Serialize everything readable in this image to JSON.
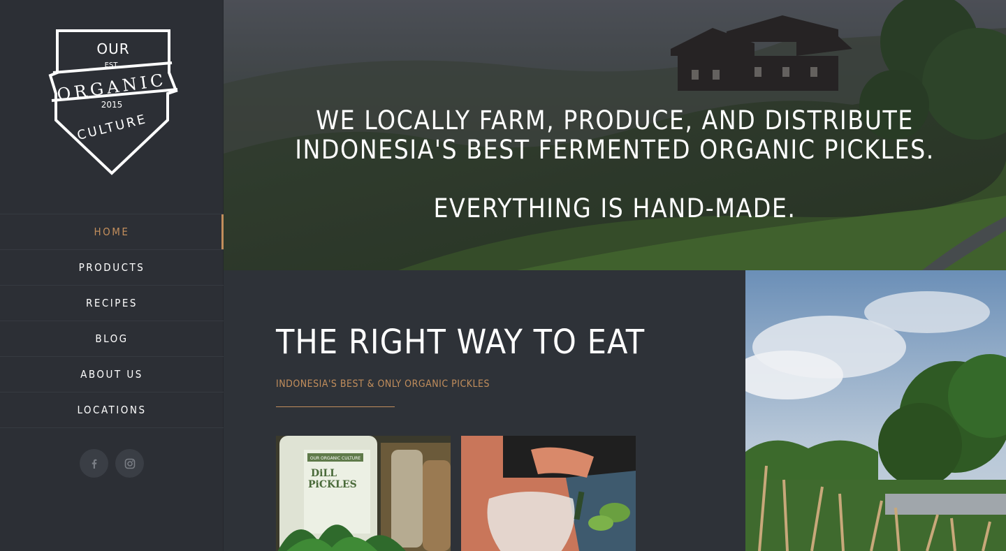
{
  "logo": {
    "line1": "OUR",
    "est": "EST.",
    "line2": "ORGANIC",
    "year": "2015",
    "line3": "CULTURE"
  },
  "nav": {
    "items": [
      {
        "label": "HOME",
        "active": true
      },
      {
        "label": "PRODUCTS",
        "active": false
      },
      {
        "label": "RECIPES",
        "active": false
      },
      {
        "label": "BLOG",
        "active": false
      },
      {
        "label": "ABOUT US",
        "active": false
      },
      {
        "label": "LOCATIONS",
        "active": false
      }
    ]
  },
  "social": {
    "facebook_icon": "facebook-icon",
    "instagram_icon": "instagram-icon"
  },
  "hero": {
    "line1": "WE LOCALLY FARM, PRODUCE, AND DISTRIBUTE",
    "line2": "INDONESIA'S BEST FERMENTED ORGANIC PICKLES.",
    "line3": "EVERYTHING IS HAND-MADE."
  },
  "section": {
    "title": "THE RIGHT WAY TO EAT",
    "subtitle": "INDONESIA'S BEST & ONLY ORGANIC PICKLES"
  },
  "thumb1": {
    "brand": "OUR ORGANIC CULTURE",
    "product_line1": "DiLL",
    "product_line2": "PiCKLES"
  },
  "colors": {
    "accent": "#c28e5c",
    "sidebar_bg": "#2c2f35",
    "content_bg": "#2e3238"
  }
}
